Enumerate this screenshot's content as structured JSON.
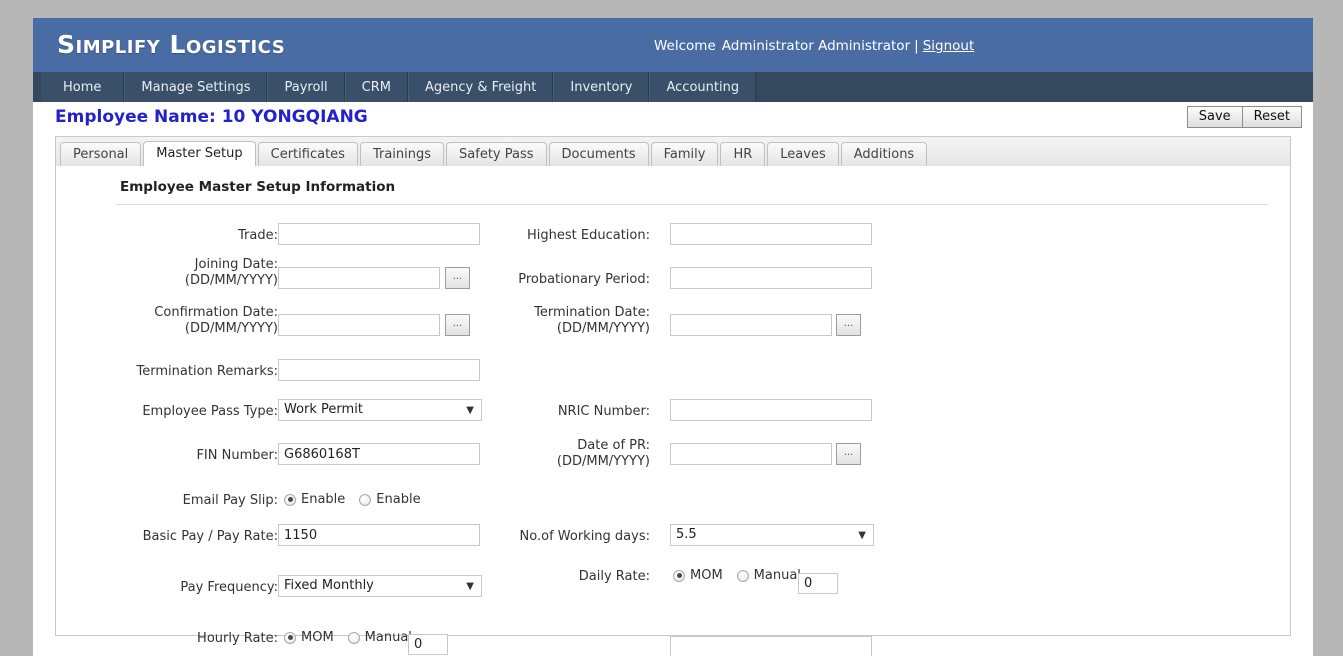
{
  "header": {
    "brand": "Simplify Logistics",
    "welcome_label": "Welcome",
    "user_name": "Administrator Administrator",
    "separator": "|",
    "signout_label": "Signout"
  },
  "nav": {
    "items": [
      {
        "label": "Home"
      },
      {
        "label": "Manage Settings"
      },
      {
        "label": "Payroll"
      },
      {
        "label": "CRM"
      },
      {
        "label": "Agency & Freight"
      },
      {
        "label": "Inventory"
      },
      {
        "label": "Accounting"
      }
    ]
  },
  "page": {
    "title": "Employee Name: 10 YONGQIANG",
    "save_label": "Save",
    "reset_label": "Reset"
  },
  "tabs": [
    {
      "label": "Personal",
      "active": false
    },
    {
      "label": "Master Setup",
      "active": true
    },
    {
      "label": "Certificates",
      "active": false
    },
    {
      "label": "Trainings",
      "active": false
    },
    {
      "label": "Safety Pass",
      "active": false
    },
    {
      "label": "Documents",
      "active": false
    },
    {
      "label": "Family",
      "active": false
    },
    {
      "label": "HR",
      "active": false
    },
    {
      "label": "Leaves",
      "active": false
    },
    {
      "label": "Additions",
      "active": false
    }
  ],
  "form": {
    "section_title": "Employee Master Setup Information",
    "trade": {
      "label": "Trade:",
      "value": ""
    },
    "highest_education": {
      "label": "Highest Education:",
      "value": ""
    },
    "joining_date": {
      "label_line1": "Joining Date:",
      "label_line2": "(DD/MM/YYYY)",
      "value": "",
      "picker_label": "..."
    },
    "probationary_period": {
      "label": "Probationary Period:",
      "value": ""
    },
    "confirmation_date": {
      "label_line1": "Confirmation Date:",
      "label_line2": "(DD/MM/YYYY)",
      "value": "",
      "picker_label": "..."
    },
    "termination_date": {
      "label_line1": "Termination Date:",
      "label_line2": "(DD/MM/YYYY)",
      "value": "",
      "picker_label": "..."
    },
    "termination_remarks": {
      "label": "Termination Remarks:",
      "value": ""
    },
    "employee_pass_type": {
      "label": "Employee Pass Type:",
      "value": "Work Permit"
    },
    "nric_number": {
      "label": "NRIC Number:",
      "value": ""
    },
    "fin_number": {
      "label": "FIN Number:",
      "value": "G6860168T"
    },
    "date_of_pr": {
      "label_line1": "Date of PR:",
      "label_line2": "(DD/MM/YYYY)",
      "value": "",
      "picker_label": "..."
    },
    "email_pay_slip": {
      "label": "Email Pay Slip:",
      "option1": "Enable",
      "option2": "Enable",
      "selected": 1
    },
    "basic_pay": {
      "label": "Basic Pay / Pay Rate:",
      "value": "1150"
    },
    "working_days": {
      "label": "No.of Working days:",
      "value": "5.5"
    },
    "pay_frequency": {
      "label": "Pay Frequency:",
      "value": "Fixed Monthly"
    },
    "daily_rate": {
      "label": "Daily Rate:",
      "option1": "MOM",
      "option2": "Manual",
      "selected": 1,
      "value": "0"
    },
    "hourly_rate": {
      "label": "Hourly Rate:",
      "option1": "MOM",
      "option2": "Manual",
      "selected": 1,
      "value": "0"
    }
  }
}
